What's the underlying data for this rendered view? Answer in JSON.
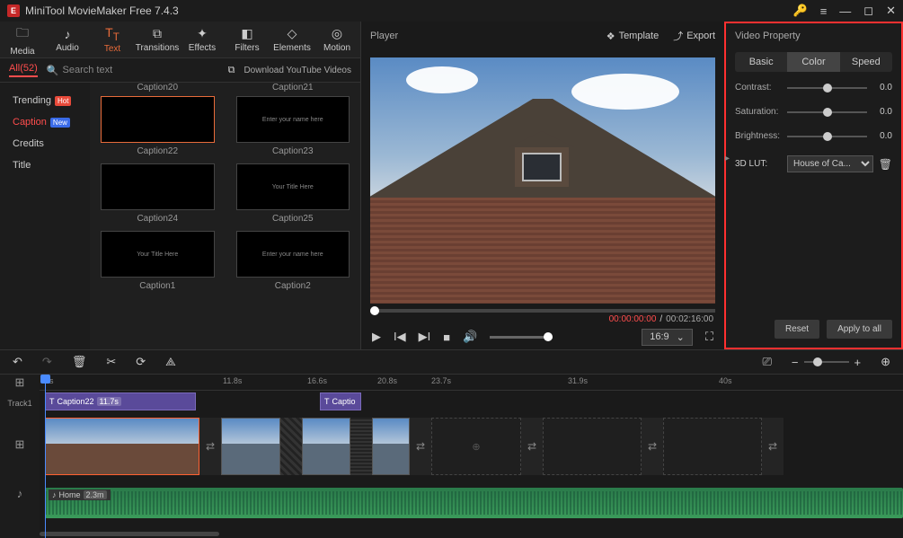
{
  "app": {
    "title": "MiniTool MovieMaker Free 7.4.3"
  },
  "tabs": {
    "media": "Media",
    "audio": "Audio",
    "text": "Text",
    "transitions": "Transitions",
    "effects": "Effects",
    "filters": "Filters",
    "elements": "Elements",
    "motion": "Motion"
  },
  "subbar": {
    "all": "All(52)",
    "search_placeholder": "Search text",
    "download": "Download YouTube Videos"
  },
  "sidebar": {
    "items": [
      {
        "label": "Trending",
        "badge": "Hot"
      },
      {
        "label": "Caption",
        "badge": "New"
      },
      {
        "label": "Credits"
      },
      {
        "label": "Title"
      }
    ]
  },
  "captions": {
    "top": [
      "Caption20",
      "Caption21"
    ],
    "list": [
      {
        "label": "Caption22",
        "hint": ""
      },
      {
        "label": "Caption23",
        "hint": "Enter your name here"
      },
      {
        "label": "Caption24",
        "hint": ""
      },
      {
        "label": "Caption25",
        "hint": "Your Title Here"
      },
      {
        "label": "Caption1",
        "hint": "Your Title Here"
      },
      {
        "label": "Caption2",
        "hint": "Enter your name here"
      }
    ]
  },
  "player": {
    "title": "Player",
    "template": "Template",
    "export": "Export",
    "current": "00:00:00:00",
    "total": "00:02:16:00",
    "aspect": "16:9"
  },
  "property": {
    "title": "Video Property",
    "tabs": {
      "basic": "Basic",
      "color": "Color",
      "speed": "Speed"
    },
    "contrast": {
      "label": "Contrast:",
      "value": "0.0"
    },
    "saturation": {
      "label": "Saturation:",
      "value": "0.0"
    },
    "brightness": {
      "label": "Brightness:",
      "value": "0.0"
    },
    "lut": {
      "label": "3D LUT:",
      "value": "House of Ca..."
    },
    "reset": "Reset",
    "apply": "Apply to all"
  },
  "timeline": {
    "track_label": "Track1",
    "ticks": [
      "0s",
      "11.8s",
      "16.6s",
      "20.8s",
      "23.7s",
      "31.9s",
      "40s"
    ],
    "caption_clips": [
      {
        "label": "Caption22",
        "dur": "11.7s"
      },
      {
        "label": "Captio",
        "dur": ""
      }
    ],
    "audio": {
      "label": "Home",
      "dur": "2.3m"
    }
  }
}
